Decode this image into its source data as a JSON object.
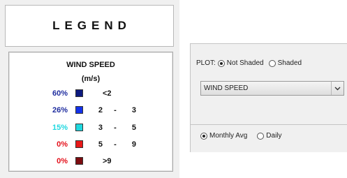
{
  "legend": {
    "title": "LEGEND",
    "heading": "WIND SPEED",
    "unit": "(m/s)",
    "rows": [
      {
        "percent": "60%",
        "percent_color": "#1f2d9f",
        "swatch_color": "#0d1a7f",
        "range_lo": "<2",
        "range_dash": "",
        "range_hi": ""
      },
      {
        "percent": "26%",
        "percent_color": "#1f2d9f",
        "swatch_color": "#1332ea",
        "range_lo": "2",
        "range_dash": "-",
        "range_hi": "3"
      },
      {
        "percent": "15%",
        "percent_color": "#1fd8e0",
        "swatch_color": "#1fd8df",
        "range_lo": "3",
        "range_dash": "-",
        "range_hi": "5"
      },
      {
        "percent": "0%",
        "percent_color": "#e4101a",
        "swatch_color": "#e81818",
        "range_lo": "5",
        "range_dash": "-",
        "range_hi": "9"
      },
      {
        "percent": "0%",
        "percent_color": "#e4101a",
        "swatch_color": "#7d0c10",
        "range_lo": ">9",
        "range_dash": "",
        "range_hi": ""
      }
    ]
  },
  "plot_options": {
    "plot_label": "PLOT:",
    "not_shaded_label": "Not Shaded",
    "shaded_label": "Shaded",
    "selected_shading": "Not Shaded",
    "variable_select": {
      "value": "WIND SPEED"
    },
    "monthly_avg_label": "Monthly Avg",
    "daily_label": "Daily",
    "selected_period": "Monthly Avg"
  }
}
